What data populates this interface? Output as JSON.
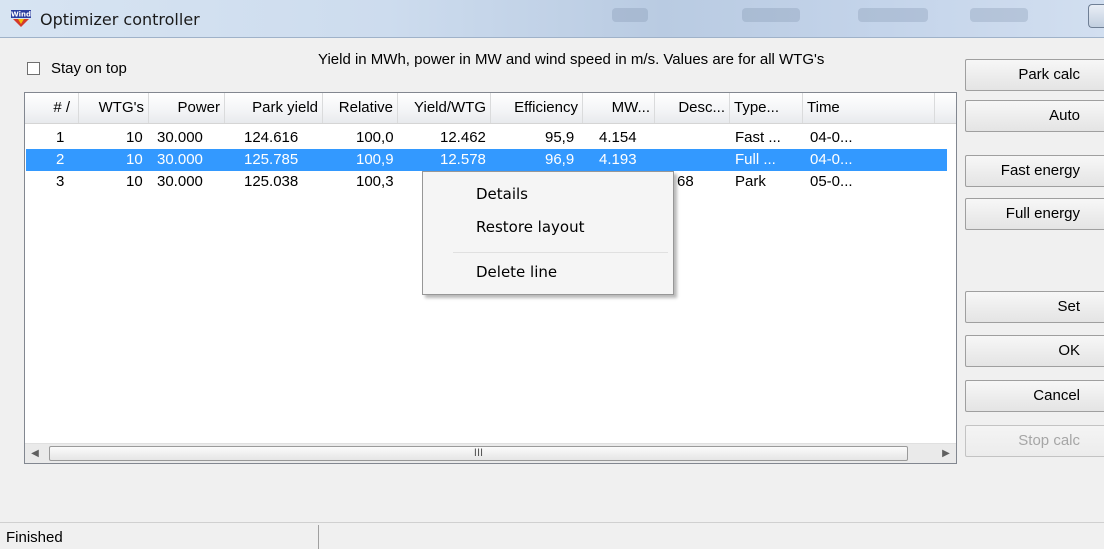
{
  "window": {
    "title": "Optimizer controller",
    "app_icon": "windpro-icon"
  },
  "header": {
    "stay_on_top": {
      "label": "Stay on top",
      "checked": false
    },
    "info": "Yield in MWh, power in MW and wind speed in m/s. Values are for all WTG's"
  },
  "table": {
    "columns": [
      "# /",
      "WTG's",
      "Power",
      "Park yield",
      "Relative",
      "Yield/WTG",
      "Efficiency",
      "MW...",
      "Desc...",
      "Type...",
      "Time"
    ],
    "rows": [
      {
        "n": "1",
        "wtgs": "10",
        "power": "30.000",
        "park_yield": "124.616",
        "relative": "100,0",
        "yield_wtg": "12.462",
        "efficiency": "95,9",
        "mw": "4.154",
        "desc": "",
        "type": "Fast ...",
        "time": "04-0..."
      },
      {
        "n": "2",
        "wtgs": "10",
        "power": "30.000",
        "park_yield": "125.785",
        "relative": "100,9",
        "yield_wtg": "12.578",
        "efficiency": "96,9",
        "mw": "4.193",
        "desc": "",
        "type": "Full ...",
        "time": "04-0..."
      },
      {
        "n": "3",
        "wtgs": "10",
        "power": "30.000",
        "park_yield": "125.038",
        "relative": "100,3",
        "yield_wtg": "",
        "efficiency": "",
        "mw": "68",
        "desc": "",
        "type": "Park",
        "time": "05-0..."
      }
    ],
    "selected_row": 2,
    "scroll_thumb_glyph": "III"
  },
  "context_menu": {
    "items": [
      "Details",
      "Restore layout",
      "Delete line"
    ]
  },
  "buttons": [
    {
      "label": "Park calc",
      "enabled": true
    },
    {
      "label": "Auto",
      "enabled": true
    },
    {
      "label": "Fast energy",
      "enabled": true
    },
    {
      "label": "Full energy",
      "enabled": true
    },
    {
      "label": "Set",
      "enabled": true
    },
    {
      "label": "OK",
      "enabled": true
    },
    {
      "label": "Cancel",
      "enabled": true
    },
    {
      "label": "Stop calc",
      "enabled": false
    }
  ],
  "status": {
    "text": "Finished"
  },
  "colors": {
    "selection": "#3399ff",
    "window_bg": "#f0f0f0",
    "titlebar": "#cddcee"
  }
}
